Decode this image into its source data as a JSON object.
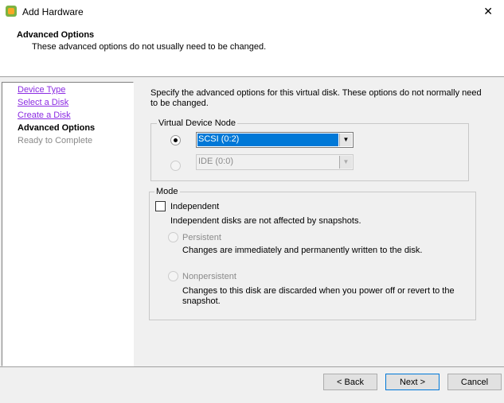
{
  "window": {
    "title": "Add Hardware",
    "close": "✕"
  },
  "header": {
    "title": "Advanced Options",
    "subtitle": "These advanced options do not usually need to be changed."
  },
  "sidebar": {
    "items": [
      {
        "label": "Device Type"
      },
      {
        "label": "Select a Disk"
      },
      {
        "label": "Create a Disk"
      },
      {
        "label": "Advanced Options"
      },
      {
        "label": "Ready to Complete"
      }
    ]
  },
  "main": {
    "intro": "Specify the advanced options for this virtual disk. These options do not normally need to be changed.",
    "vdn": {
      "legend": "Virtual Device Node",
      "scsi": "SCSI (0:2)",
      "ide": "IDE (0:0)"
    },
    "mode": {
      "legend": "Mode",
      "independent": "Independent",
      "independent_desc": "Independent disks are not affected by snapshots.",
      "persistent": "Persistent",
      "persistent_desc": "Changes are immediately and permanently written to the disk.",
      "nonpersistent": "Nonpersistent",
      "nonpersistent_desc": "Changes to this disk are discarded when you power off or revert to the snapshot."
    }
  },
  "buttons": {
    "back": "< Back",
    "next": "Next >",
    "cancel": "Cancel"
  }
}
